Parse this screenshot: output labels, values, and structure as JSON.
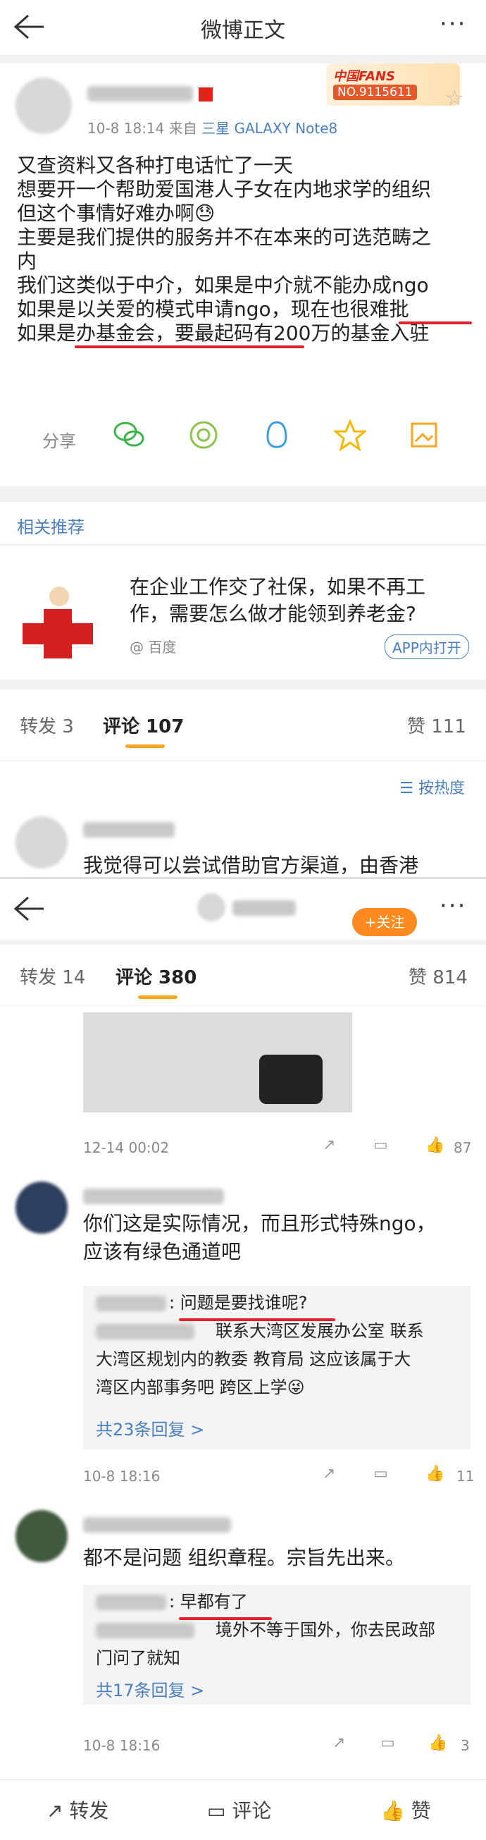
{
  "screen1": {
    "title": "微博正文",
    "post": {
      "meta_time": "10-8 18:14",
      "meta_from": "来自",
      "meta_device": "三星 GALAXY Note8",
      "badge_title": "中国FANS",
      "badge_no": "NO.9115611",
      "lines": [
        "又查资料又各种打电话忙了一天",
        "想要开一个帮助爱国港人子女在内地求学的组织",
        "但这个事情好难办啊😓",
        "主要是我们提供的服务并不在本来的可选范畴之",
        "内",
        "我们这类似于中介，如果是中介就不能办成ngo",
        "如果是以关爱的模式申请ngo，现在也很难批",
        "如果是办基金会，要最起码有200万的基金入驻"
      ],
      "share_label": "分享"
    },
    "related": {
      "heading": "相关推荐",
      "text": "在企业工作交了社保，如果不再工作，需要怎么做才能领到养老金?",
      "source": "@ 百度",
      "app_button": "APP内打开"
    },
    "tabs": {
      "repost": "转发 3",
      "comment": "评论 107",
      "like": "赞 111"
    },
    "sort_label": "按热度",
    "first_comment": "我觉得可以尝试借助官方渠道，由香港"
  },
  "screen2": {
    "follow_button": "+关注",
    "tabs": {
      "repost": "转发 14",
      "comment": "评论 380",
      "like": "赞 814"
    },
    "comments": [
      {
        "time": "12-14 00:02",
        "likes": "87"
      },
      {
        "lines": [
          "你们这是实际情况，而且形式特殊ngo，",
          "应该有绿色通道吧"
        ],
        "reply1_text": ": 问题是要找谁呢?",
        "reply2_lines": [
          "联系大湾区发展办公室 联系",
          "大湾区规划内的教委 教育局 这应该属于大",
          "湾区内部事务吧 跨区上学😜"
        ],
        "more_link": "共23条回复 >",
        "time": "10-8 18:16",
        "likes": "11"
      },
      {
        "lines": [
          "都不是问题 组织章程。宗旨先出来。"
        ],
        "reply1_text": ": 早都有了",
        "reply2_lines": [
          "境外不等于国外，你去民政部",
          "门问了就知"
        ],
        "more_link": "共17条回复 >",
        "time": "10-8 18:16",
        "likes": "3"
      }
    ],
    "bottom": {
      "repost": "转发",
      "comment": "评论",
      "like": "赞"
    }
  },
  "colors": {
    "accent": "#ff8a1f",
    "link": "#4a7fbf",
    "underline": "#e0202a"
  }
}
